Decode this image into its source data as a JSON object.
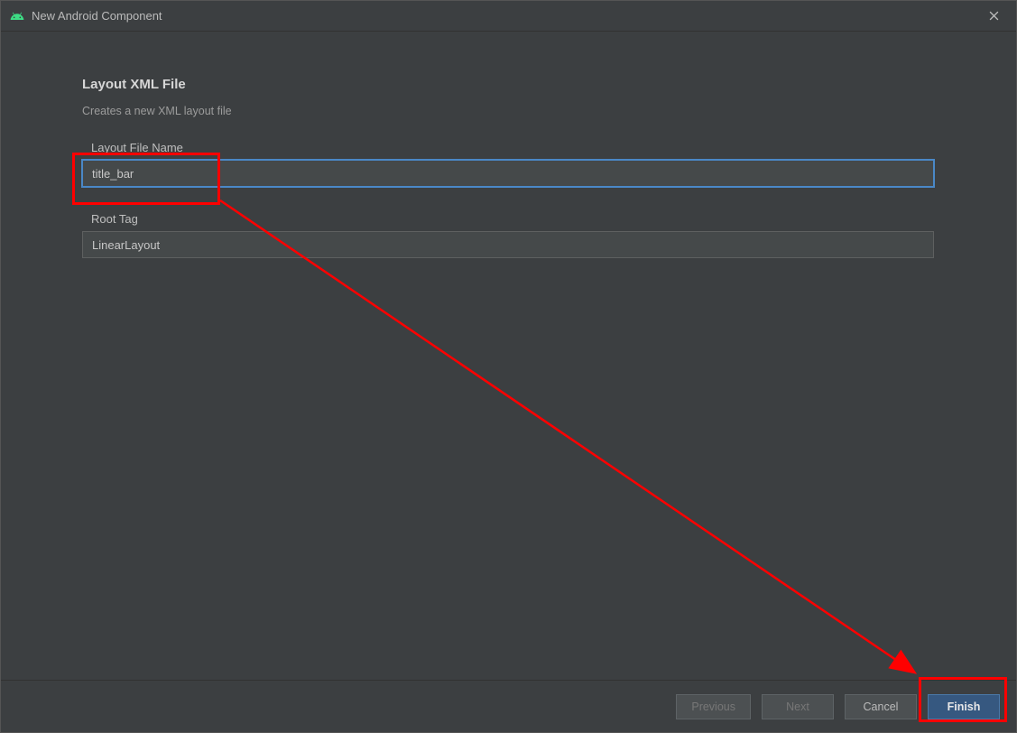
{
  "window": {
    "title": "New Android Component"
  },
  "page": {
    "heading": "Layout XML File",
    "subheading": "Creates a new XML layout file"
  },
  "fields": {
    "filename": {
      "label": "Layout File Name",
      "value": "title_bar"
    },
    "roottag": {
      "label": "Root Tag",
      "value": "LinearLayout"
    }
  },
  "buttons": {
    "previous": "Previous",
    "next": "Next",
    "cancel": "Cancel",
    "finish": "Finish"
  },
  "annotations": {
    "highlight_input": true,
    "highlight_finish": true,
    "arrow_from_input_to_finish": true
  }
}
